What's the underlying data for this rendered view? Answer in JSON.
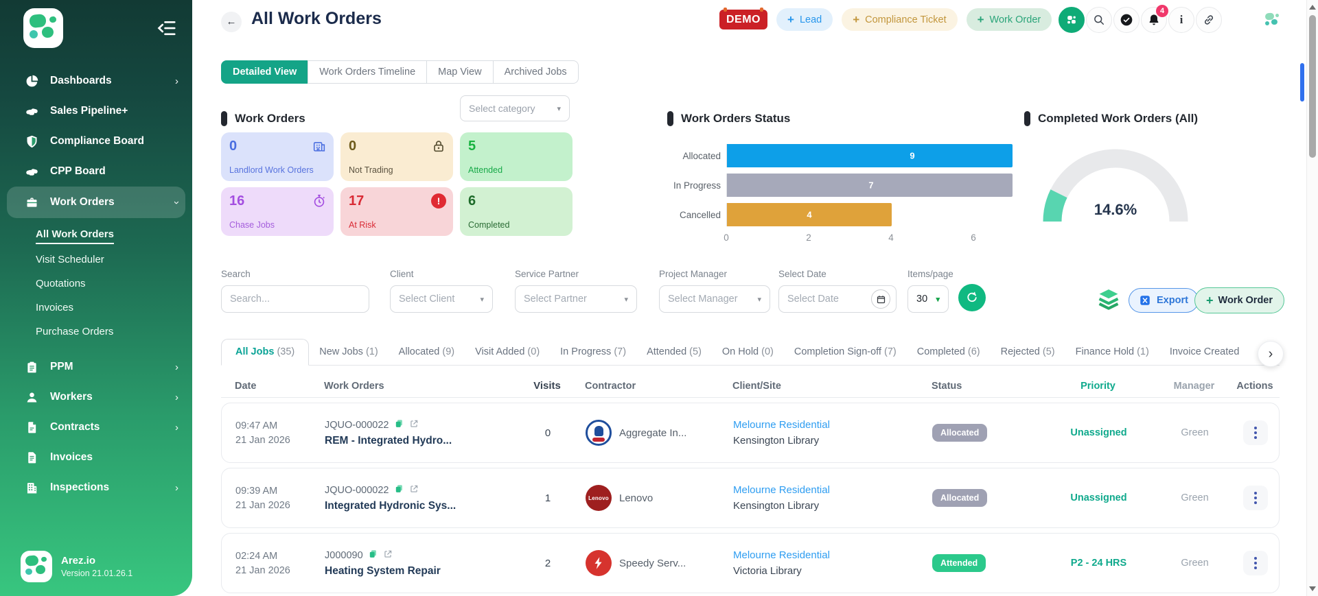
{
  "app": {
    "name": "Arez.io",
    "version": "Version 21.01.26.1"
  },
  "sidebar": {
    "main_items": [
      {
        "label": "Dashboards",
        "icon": "pie-chart",
        "chevron": "right"
      },
      {
        "label": "Sales Pipeline+",
        "icon": "handshake",
        "chevron": ""
      },
      {
        "label": "Compliance Board",
        "icon": "shield",
        "chevron": ""
      },
      {
        "label": "CPP Board",
        "icon": "handshake",
        "chevron": ""
      },
      {
        "label": "Work Orders",
        "icon": "briefcase",
        "chevron": "down",
        "active": true
      }
    ],
    "sub_items": [
      {
        "label": "All Work Orders",
        "active": true
      },
      {
        "label": "Visit Scheduler",
        "active": false
      },
      {
        "label": "Quotations",
        "active": false
      },
      {
        "label": "Invoices",
        "active": false
      },
      {
        "label": "Purchase Orders",
        "active": false
      }
    ],
    "more_items": [
      {
        "label": "PPM",
        "icon": "clipboard",
        "chevron": "right"
      },
      {
        "label": "Workers",
        "icon": "person",
        "chevron": "right"
      },
      {
        "label": "Contracts",
        "icon": "file",
        "chevron": "right"
      },
      {
        "label": "Invoices",
        "icon": "invoice",
        "chevron": ""
      },
      {
        "label": "Inspections",
        "icon": "building",
        "chevron": "right"
      }
    ]
  },
  "header": {
    "back": "←",
    "title": "All Work Orders",
    "demo_label": "DEMO",
    "quick_actions": [
      {
        "plus": "+",
        "label": "Lead",
        "theme": "lead"
      },
      {
        "plus": "+",
        "label": "Compliance Ticket",
        "theme": "compliance"
      },
      {
        "plus": "+",
        "label": "Work Order",
        "theme": "workorder"
      }
    ],
    "notification_count": "4",
    "info_glyph": "i"
  },
  "view_tabs": [
    {
      "label": "Detailed View",
      "active": true
    },
    {
      "label": "Work Orders Timeline",
      "active": false
    },
    {
      "label": "Map View",
      "active": false
    },
    {
      "label": "Archived Jobs",
      "active": false
    }
  ],
  "summary": {
    "title": "Work Orders",
    "category_placeholder": "Select category",
    "cards": [
      {
        "value": "0",
        "label": "Landlord Work Orders",
        "icon": "building-outline",
        "theme": "blue"
      },
      {
        "value": "0",
        "label": "Not Trading",
        "icon": "lock",
        "theme": "amber"
      },
      {
        "value": "5",
        "label": "Attended",
        "icon": "",
        "theme": "green"
      },
      {
        "value": "16",
        "label": "Chase Jobs",
        "icon": "stopwatch",
        "theme": "purple"
      },
      {
        "value": "17",
        "label": "At Risk",
        "icon": "alert",
        "theme": "red"
      },
      {
        "value": "6",
        "label": "Completed",
        "icon": "",
        "theme": "dgreen"
      }
    ]
  },
  "chart_data": [
    {
      "type": "bar",
      "orientation": "horizontal",
      "title": "Work Orders Status",
      "categories": [
        "Allocated",
        "In Progress",
        "Cancelled"
      ],
      "values": [
        9,
        7,
        4
      ],
      "colors": [
        "#0d9fe8",
        "#a6a9ba",
        "#dfa23a"
      ],
      "ticks": [
        0,
        2,
        4,
        6
      ],
      "xlim": [
        0,
        6.93
      ],
      "grid": false,
      "value_labels": "inside-white"
    },
    {
      "type": "gauge",
      "title": "Completed Work Orders (All)",
      "value": 14.6,
      "label": "14.6%",
      "range": [
        0,
        100
      ],
      "color": "#58d5b0",
      "track_color": "#e8e9eb"
    }
  ],
  "filters": [
    {
      "label": "Search",
      "kind": "input",
      "placeholder": "Search..."
    },
    {
      "label": "Client",
      "kind": "select",
      "value": "Select Client"
    },
    {
      "label": "Service Partner",
      "kind": "select",
      "value": "Select Partner"
    },
    {
      "label": "Project Manager",
      "kind": "select",
      "value": "Select Manager"
    },
    {
      "label": "Select Date",
      "kind": "date",
      "value": "Select Date"
    },
    {
      "label": "Items/page",
      "kind": "items",
      "value": "30"
    }
  ],
  "list_actions": {
    "export_label": "Export",
    "add_label": "Work Order",
    "add_plus": "+"
  },
  "job_tabs": [
    {
      "label": "All Jobs",
      "count_display": "(35)",
      "active": true
    },
    {
      "label": "New Jobs",
      "count_display": "(1)",
      "active": false
    },
    {
      "label": "Allocated",
      "count_display": "(9)",
      "active": false
    },
    {
      "label": "Visit Added",
      "count_display": "(0)",
      "active": false
    },
    {
      "label": "In Progress",
      "count_display": "(7)",
      "active": false
    },
    {
      "label": "Attended",
      "count_display": "(5)",
      "active": false
    },
    {
      "label": "On Hold",
      "count_display": "(0)",
      "active": false
    },
    {
      "label": "Completion Sign-off",
      "count_display": "(7)",
      "active": false
    },
    {
      "label": "Completed",
      "count_display": "(6)",
      "active": false
    },
    {
      "label": "Rejected",
      "count_display": "(5)",
      "active": false
    },
    {
      "label": "Finance Hold",
      "count_display": "(1)",
      "active": false
    },
    {
      "label": "Invoice Created",
      "count_display": "",
      "active": false
    }
  ],
  "table": {
    "headers": [
      "Date",
      "Work Orders",
      "Visits",
      "Contractor",
      "Client/Site",
      "Status",
      "Priority",
      "Manager",
      "Actions"
    ],
    "rows": [
      {
        "time": "09:47 AM",
        "date": "21 Jan 2026",
        "code": "JQUO-000022",
        "title": "REM - Integrated Hydro...",
        "visits": "0",
        "contractor_name": "Aggregate In...",
        "contractor_logo": "aggregate",
        "contractor_logo_text": "",
        "client": "Melourne Residential",
        "site": "Kensington Library",
        "status": "Allocated",
        "priority": "Unassigned",
        "manager": "Green"
      },
      {
        "time": "09:39 AM",
        "date": "21 Jan 2026",
        "code": "JQUO-000022",
        "title": "Integrated Hydronic Sys...",
        "visits": "1",
        "contractor_name": "Lenovo",
        "contractor_logo": "lenovo",
        "contractor_logo_text": "Lenovo",
        "client": "Melourne Residential",
        "site": "Kensington Library",
        "status": "Allocated",
        "priority": "Unassigned",
        "manager": "Green"
      },
      {
        "time": "02:24 AM",
        "date": "21 Jan 2026",
        "code": "J000090",
        "title": "Heating System Repair",
        "visits": "2",
        "contractor_name": "Speedy Serv...",
        "contractor_logo": "speedy",
        "contractor_logo_text": "",
        "client": "Melourne Residential",
        "site": "Victoria Library",
        "status": "Attended",
        "priority": "P2 - 24 HRS",
        "manager": "Green"
      }
    ]
  }
}
